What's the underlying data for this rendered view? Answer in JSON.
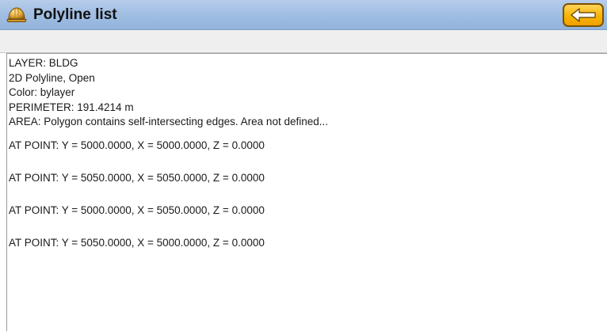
{
  "window": {
    "title": "Polyline list",
    "app_icon": "hard-hat-icon",
    "back_button_icon": "arrow-left-icon",
    "accent_color": "#f8b400",
    "titlebar_color": "#a2bfe3"
  },
  "info": {
    "layer": "LAYER: BLDG",
    "type": "2D Polyline, Open",
    "color": "Color: bylayer",
    "perimeter": "PERIMETER: 191.4214 m",
    "area": "AREA: Polygon contains self-intersecting edges. Area not defined..."
  },
  "points": [
    "AT POINT: Y = 5000.0000, X = 5000.0000, Z = 0.0000",
    "AT POINT: Y = 5050.0000, X = 5050.0000, Z = 0.0000",
    "AT POINT: Y = 5000.0000, X = 5050.0000, Z = 0.0000",
    "AT POINT: Y = 5050.0000, X = 5000.0000, Z = 0.0000"
  ]
}
